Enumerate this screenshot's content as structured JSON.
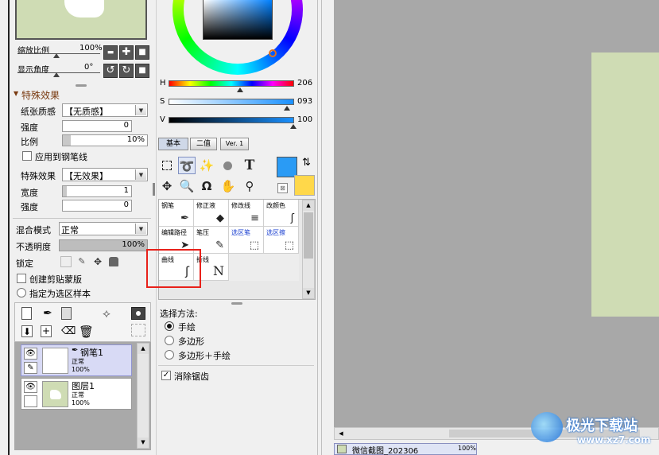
{
  "navigator": {
    "zoom_label": "缩放比例",
    "zoom_value": "100%",
    "angle_label": "显示角度",
    "angle_value": "0°",
    "zoom_out": "▬",
    "zoom_in": "✚",
    "zoom_reset": "■",
    "rotate_left": "↺",
    "rotate_right": "↻",
    "rotate_reset": "■"
  },
  "effects": {
    "section_title": "特殊效果",
    "paper_label": "纸张质感",
    "paper_value": "【无质感】",
    "strength_label": "强度",
    "strength_value": "0",
    "ratio_label": "比例",
    "ratio_value": "10%",
    "apply_pen_label": "应用到钢笔线",
    "effect_label": "特殊效果",
    "effect_value": "【无效果】",
    "width_label": "宽度",
    "width_value": "1",
    "strength2_label": "强度",
    "strength2_value": "0"
  },
  "layer_props": {
    "blend_label": "混合模式",
    "blend_value": "正常",
    "opacity_label": "不透明度",
    "opacity_value": "100%",
    "lock_label": "锁定",
    "clip_label": "创建剪贴蒙版",
    "sample_label": "指定为选区样本"
  },
  "layers": [
    {
      "name": "钢笔1",
      "mode": "正常",
      "opacity": "100%"
    },
    {
      "name": "图层1",
      "mode": "正常",
      "opacity": "100%"
    }
  ],
  "color": {
    "h_label": "H",
    "h_value": "206",
    "s_label": "S",
    "s_value": "093",
    "v_label": "V",
    "v_value": "100",
    "primary": "#2a9bf5",
    "secondary": "#ffd84a"
  },
  "tool_tabs": [
    "基本",
    "二值",
    "Ver. 1"
  ],
  "brushes": [
    {
      "label": "钢笔",
      "blue": false
    },
    {
      "label": "修正液",
      "blue": false
    },
    {
      "label": "修改线",
      "blue": false
    },
    {
      "label": "改颜色",
      "blue": false
    },
    {
      "label": "编辑路径",
      "blue": false
    },
    {
      "label": "笔压",
      "blue": false
    },
    {
      "label": "选区笔",
      "blue": true
    },
    {
      "label": "选区擦",
      "blue": true
    },
    {
      "label": "曲线",
      "blue": false
    },
    {
      "label": "折线",
      "blue": false
    }
  ],
  "options": {
    "method_label": "选择方法:",
    "methods": [
      "手绘",
      "多边形",
      "多边形＋手绘"
    ],
    "antialias_label": "消除锯齿"
  },
  "status": {
    "file_name": "微信截图_202306",
    "zoom": "100%"
  },
  "watermark": {
    "brand": "极光下载站",
    "url": "www.xz7.com"
  }
}
